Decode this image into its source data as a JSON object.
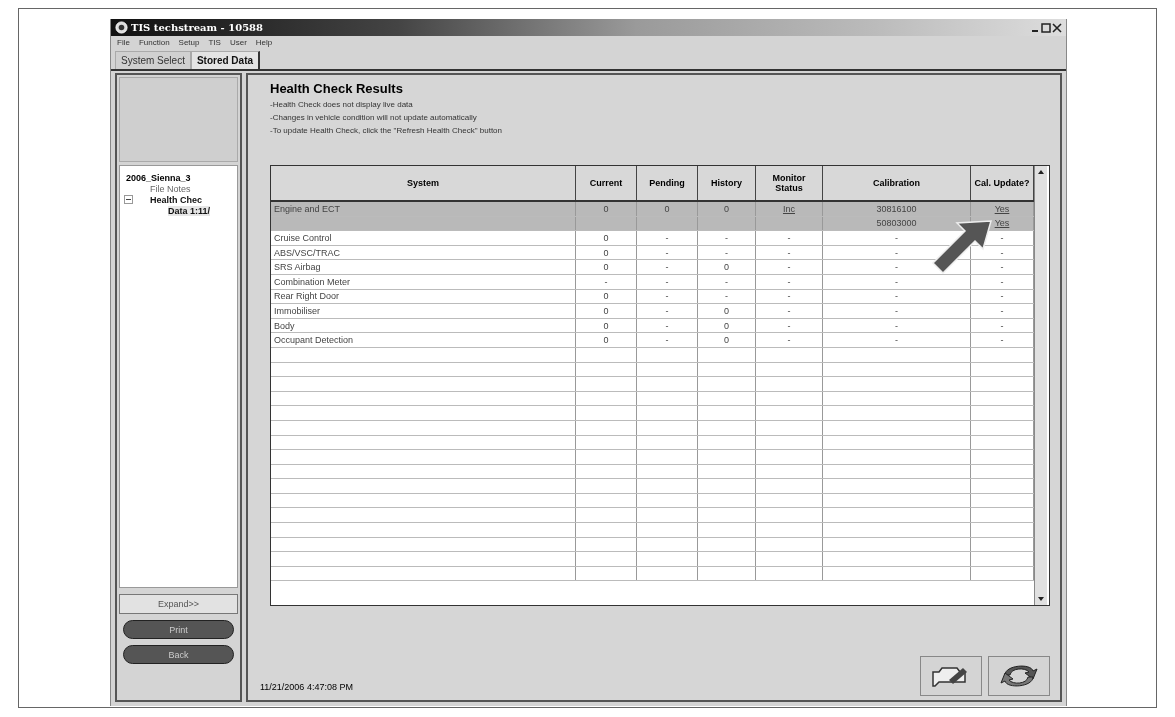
{
  "window": {
    "title": "TIS techstream - 10588"
  },
  "menu": [
    "File",
    "Function",
    "Setup",
    "TIS",
    "User",
    "Help"
  ],
  "tabs": [
    {
      "label": "System Select",
      "selected": false
    },
    {
      "label": "Stored Data",
      "selected": true
    }
  ],
  "tree": [
    {
      "label": "2006_Sienna_3",
      "selected": false,
      "children": [
        {
          "label": "File Notes",
          "selected": false
        },
        {
          "label": "Health Chec",
          "expanded": true,
          "selected": false,
          "children": [
            {
              "label": "Data 1:11/",
              "selected": true
            }
          ]
        }
      ]
    }
  ],
  "side_buttons": [
    {
      "label": "Expand>>",
      "kind": "plain"
    },
    {
      "label": "Print",
      "kind": "pill"
    },
    {
      "label": "Back",
      "kind": "pill"
    }
  ],
  "heading": "Health Check Results",
  "notes": [
    "-Health Check does not display live data",
    "-Changes in vehicle condition will not update automatically",
    "-To update Health Check, click the \"Refresh Health Check\" button"
  ],
  "table": {
    "columns": [
      "System",
      "Current",
      "Pending",
      "History",
      "Monitor Status",
      "Calibration",
      "Cal. Update?"
    ],
    "rows": [
      {
        "selected": true,
        "cells": [
          "Engine and ECT",
          "0",
          "0",
          "0",
          "Inc",
          "30816100",
          "Yes"
        ]
      },
      {
        "selected": true,
        "cells": [
          "",
          "",
          "",
          "",
          "",
          "50803000",
          "Yes"
        ]
      },
      {
        "selected": false,
        "cells": [
          "Cruise Control",
          "0",
          "-",
          "-",
          "-",
          "-",
          "-"
        ]
      },
      {
        "selected": false,
        "cells": [
          "ABS/VSC/TRAC",
          "0",
          "-",
          "-",
          "-",
          "-",
          "-"
        ]
      },
      {
        "selected": false,
        "cells": [
          "SRS Airbag",
          "0",
          "-",
          "0",
          "-",
          "-",
          "-"
        ]
      },
      {
        "selected": false,
        "cells": [
          "Combination Meter",
          "-",
          "-",
          "-",
          "-",
          "-",
          "-"
        ]
      },
      {
        "selected": false,
        "cells": [
          "Rear Right Door",
          "0",
          "-",
          "-",
          "-",
          "-",
          "-"
        ]
      },
      {
        "selected": false,
        "cells": [
          "Immobiliser",
          "0",
          "-",
          "0",
          "-",
          "-",
          "-"
        ]
      },
      {
        "selected": false,
        "cells": [
          "Body",
          "0",
          "-",
          "0",
          "-",
          "-",
          "-"
        ]
      },
      {
        "selected": false,
        "cells": [
          "Occupant Detection",
          "0",
          "-",
          "0",
          "-",
          "-",
          "-"
        ]
      }
    ]
  },
  "timestamp": "11/21/2006 4:47:08 PM"
}
